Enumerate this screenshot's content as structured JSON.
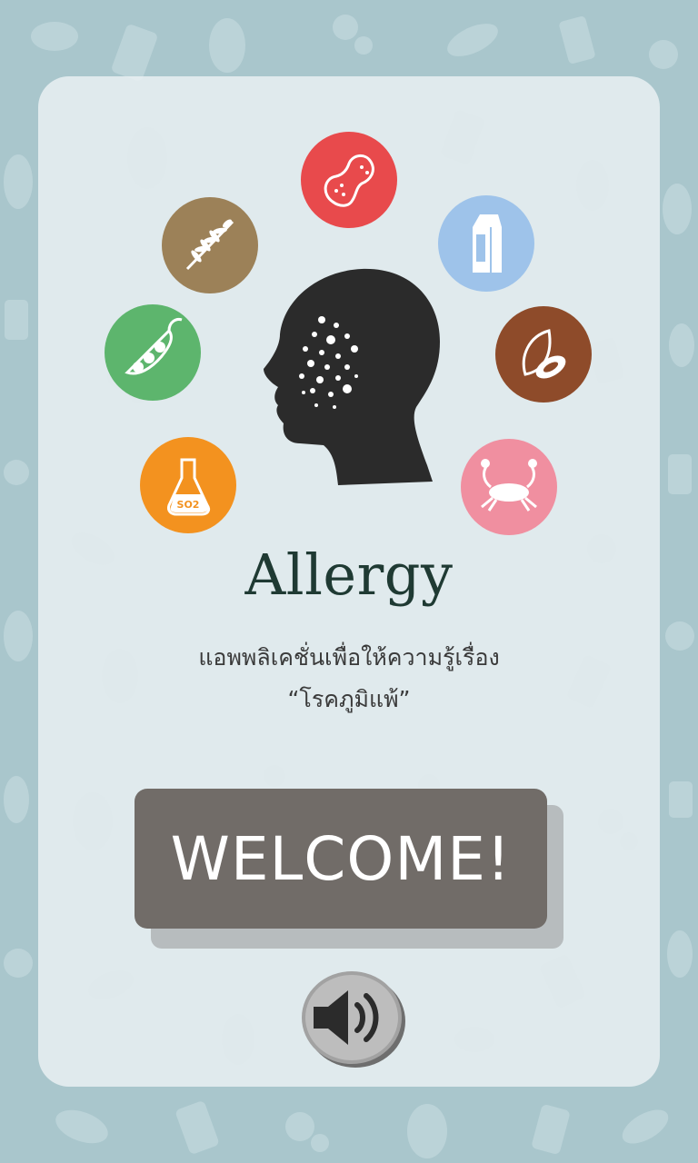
{
  "app": {
    "title": "Allergy",
    "subtitle_line1": "แอพพลิเคชั่นเพื่อให้ความรู้เรื่อง",
    "subtitle_line2": "“โรคภูมิแพ้”"
  },
  "welcome_button": {
    "label": "WELCOME!"
  },
  "sound_button": {
    "icon": "speaker-icon",
    "state": "on"
  },
  "allergens": [
    {
      "name": "peanut",
      "icon": "peanut-icon",
      "color": "#e84a4c"
    },
    {
      "name": "milk",
      "icon": "milk-carton-icon",
      "color": "#9ec3ea"
    },
    {
      "name": "seeds",
      "icon": "seed-icon",
      "color": "#8e4b2a"
    },
    {
      "name": "shellfish",
      "icon": "crab-icon",
      "color": "#f08fa0"
    },
    {
      "name": "sulfites",
      "icon": "flask-so2-icon",
      "color": "#f3921f",
      "label": "SO2"
    },
    {
      "name": "soy",
      "icon": "soybean-icon",
      "color": "#5db56d"
    },
    {
      "name": "wheat",
      "icon": "wheat-icon",
      "color": "#9c8158"
    }
  ],
  "colors": {
    "background": "#a9c6cc",
    "card": "#ebf2f4",
    "button": "#716c68",
    "button_shadow": "#b7bcbe",
    "title": "#1f3a33",
    "head": "#2b2b2b"
  }
}
